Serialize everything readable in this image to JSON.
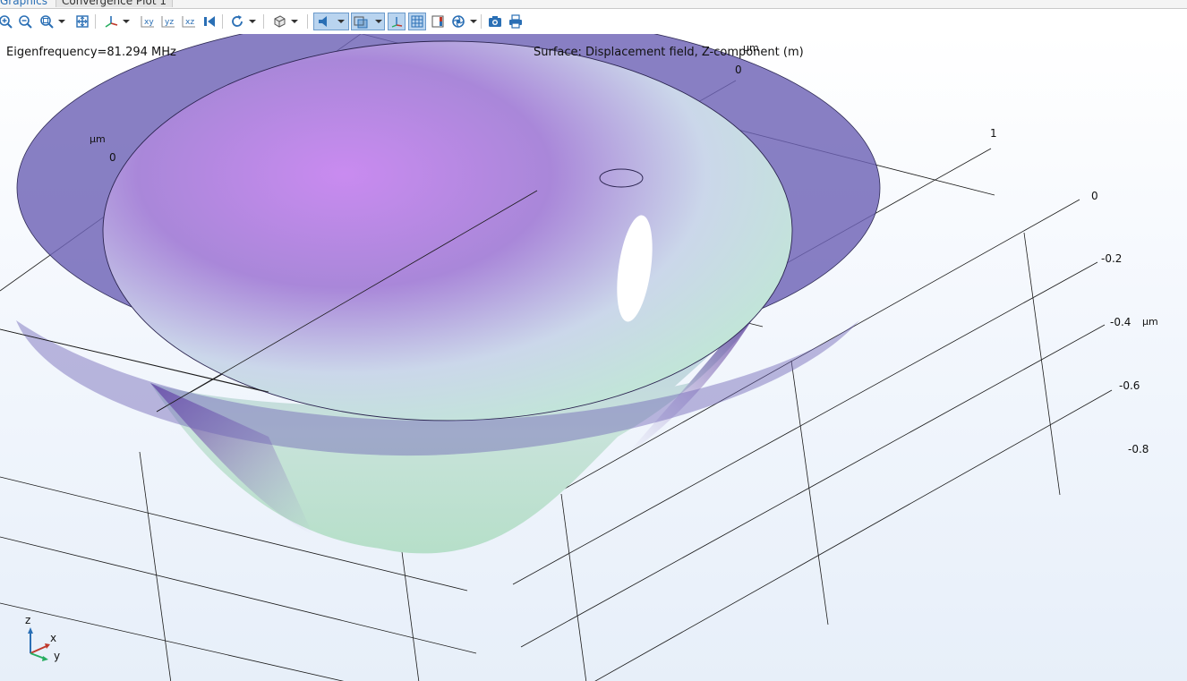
{
  "tabs": [
    {
      "label": "Graphics",
      "active": true
    },
    {
      "label": "Convergence Plot 1",
      "active": false
    }
  ],
  "toolbar": {
    "buttons": [
      {
        "id": "zoom-in",
        "icon": "zoom-in-icon"
      },
      {
        "id": "zoom-out",
        "icon": "zoom-out-icon"
      },
      {
        "id": "zoom-box",
        "icon": "zoom-box-icon",
        "dropdown": true
      },
      {
        "id": "zoom-extents",
        "icon": "zoom-extents-icon"
      },
      {
        "id": "view-axis",
        "icon": "axis-orientation-icon",
        "dropdown": true
      },
      {
        "id": "view-xy",
        "icon": "xy-plane-icon"
      },
      {
        "id": "view-yz",
        "icon": "yz-plane-icon"
      },
      {
        "id": "view-xz",
        "icon": "xz-plane-icon"
      },
      {
        "id": "go-to-view",
        "icon": "camera-view-icon"
      },
      {
        "id": "rotate",
        "icon": "rotate-icon",
        "dropdown": true
      },
      {
        "id": "render",
        "icon": "render-mode-icon",
        "dropdown": true
      },
      {
        "id": "lights",
        "icon": "headlight-icon",
        "active": true,
        "dropdown": true
      },
      {
        "id": "transparency",
        "icon": "transparency-icon",
        "active": true,
        "dropdown": true
      },
      {
        "id": "axis-toggle",
        "icon": "show-axis-icon",
        "active": true
      },
      {
        "id": "grid-toggle",
        "icon": "show-grid-icon",
        "active": true
      },
      {
        "id": "legend-toggle",
        "icon": "show-legend-icon"
      },
      {
        "id": "scene-light",
        "icon": "scene-light-icon",
        "dropdown": true
      },
      {
        "id": "snapshot",
        "icon": "snapshot-camera-icon"
      },
      {
        "id": "print",
        "icon": "printer-icon"
      }
    ]
  },
  "plot": {
    "eigenfrequency_label": "Eigenfrequency=81.294 MHz",
    "surface_title": "Surface: Displacement field, Z-component (m)"
  },
  "axes": {
    "top_unit": "µm",
    "top_zero": "0",
    "left_unit": "µm",
    "left_zero": "0",
    "right_one": "1",
    "z_ticks": [
      "0",
      "-0.2",
      "-0.4",
      "-0.6",
      "-0.8"
    ],
    "z_unit": "µm"
  },
  "triad": {
    "z": "z",
    "x": "x",
    "y": "y"
  },
  "colors": {
    "active_button": "#b9d4ef",
    "flange": "#6e63b6",
    "dish_high": "#c47be6",
    "dish_low": "#bfe8d4"
  }
}
